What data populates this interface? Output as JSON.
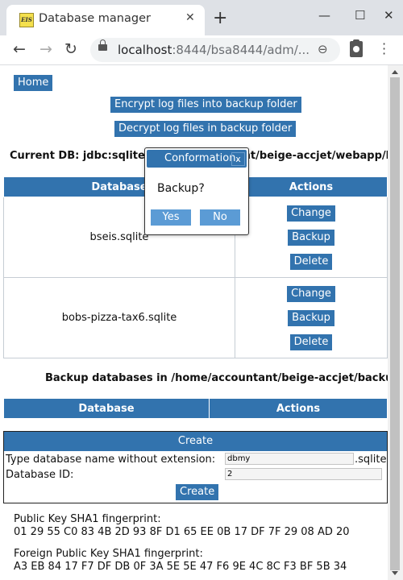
{
  "browser": {
    "tab_title": "Database manager",
    "favicon_text": "EIS",
    "url_host": "localhost",
    "url_rest": ":8444/bsa8444/adm/..."
  },
  "page": {
    "home": "Home",
    "encrypt": "Encrypt log files into backup folder",
    "decrypt": "Decrypt log files in backup folder",
    "current_db": "Current DB: jdbc:sqlite:/home/accountant/beige-accjet/webapp/bseis.sqlite",
    "table": {
      "col_database": "Database",
      "col_actions": "Actions",
      "rows": [
        {
          "name": "bseis.sqlite",
          "change": "Change",
          "backup": "Backup",
          "delete": "Delete"
        },
        {
          "name": "bobs-pizza-tax6.sqlite",
          "change": "Change",
          "backup": "Backup",
          "delete": "Delete"
        }
      ]
    },
    "backup_heading": "Backup databases in /home/accountant/beige-accjet/backup:",
    "backup_table": {
      "col_database": "Database",
      "col_actions": "Actions"
    },
    "create": {
      "header": "Create",
      "name_label": "Type database name without extension:",
      "name_value": "dbmy",
      "ext": ".sqlite",
      "id_label": "Database ID:",
      "id_value": "2",
      "button": "Create"
    },
    "fingerprints": {
      "public_label": "Public Key SHA1 fingerprint:",
      "public_value": "01 29 55 C0 83 4B 2D 93 8F D1 65 EE 0B 17 DF 7F 29 08 AD 20",
      "foreign_label": "Foreign Public Key SHA1 fingerprint:",
      "foreign_value": "A3 EB 84 17 F7 DF DB 0F 3A 5E 5E 47 F6 9E 4C 8C F3 BF 5B 34"
    }
  },
  "dialog": {
    "title": "Conformation.",
    "close": "x",
    "message": "Backup?",
    "yes": "Yes",
    "no": "No"
  },
  "colors": {
    "accent": "#3273ae",
    "dialog_button": "#5b9bd5"
  }
}
